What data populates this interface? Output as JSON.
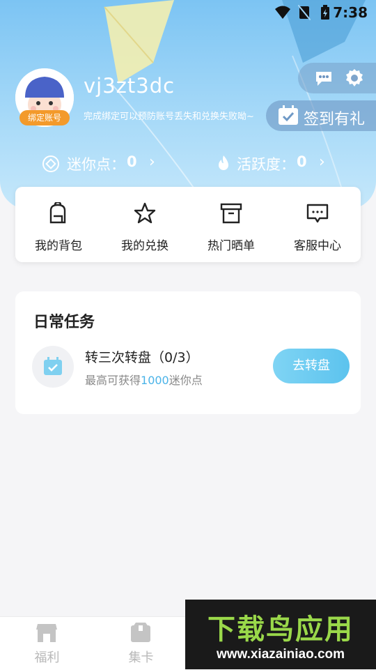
{
  "status_bar": {
    "time": "7:38"
  },
  "profile": {
    "username": "vj3zt3dc",
    "bind_badge": "绑定账号",
    "bind_tip": "完成绑定可以预防账号丢失和兑换失败呦~"
  },
  "header_actions": {
    "message_icon": "chat-bubble-icon",
    "settings_icon": "gear-icon",
    "signin_label": "签到有礼"
  },
  "stats": {
    "mini_points": {
      "label": "迷你点：",
      "value": "0"
    },
    "activity": {
      "label": "活跃度：",
      "value": "0"
    }
  },
  "menu": {
    "items": [
      {
        "label": "我的背包",
        "icon": "backpack-icon"
      },
      {
        "label": "我的兑换",
        "icon": "star-icon"
      },
      {
        "label": "热门晒单",
        "icon": "box-icon"
      },
      {
        "label": "客服中心",
        "icon": "chat-icon"
      }
    ]
  },
  "daily_tasks": {
    "title": "日常任务",
    "task": {
      "name": "转三次转盘（0/3）",
      "sub_prefix": "最高可获得",
      "sub_amount": "1000",
      "sub_suffix": "迷你点",
      "button": "去转盘"
    }
  },
  "tabbar": {
    "items": [
      {
        "label": "福利",
        "icon": "shop-icon"
      },
      {
        "label": "集卡",
        "icon": "card-box-icon"
      }
    ]
  },
  "watermark": {
    "title": "下载鸟应用",
    "url": "www.xiazainiao.com"
  },
  "colors": {
    "accent": "#5cc3ee",
    "badge": "#f39a2b",
    "highlight": "#4ab3e8"
  }
}
